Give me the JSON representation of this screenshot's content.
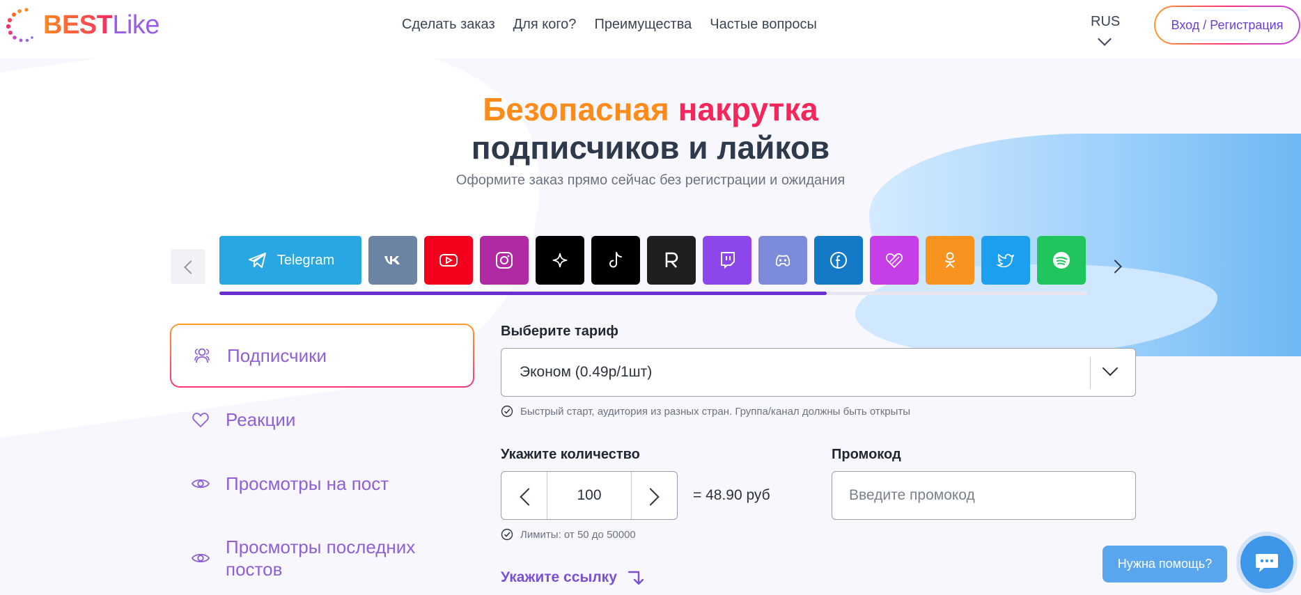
{
  "header": {
    "logo_best": "BEST",
    "logo_like": "Like",
    "nav": [
      "Сделать заказ",
      "Для кого?",
      "Преимущества",
      "Частые вопросы"
    ],
    "language": "RUS",
    "login_label": "Вход / Регистрация"
  },
  "hero": {
    "title_word1": "Безопасная",
    "title_word2": "накрутка",
    "title_line2": "подписчиков и лайков",
    "subtitle": "Оформите заказ прямо сейчас без регистрации и ожидания"
  },
  "platforms": {
    "active_label": "Telegram",
    "items": [
      {
        "name": "telegram",
        "color": "#28a7e3"
      },
      {
        "name": "vk",
        "color": "#6c84a3"
      },
      {
        "name": "youtube",
        "color": "#f2001c"
      },
      {
        "name": "instagram",
        "color": "#b02aa3"
      },
      {
        "name": "threads",
        "color": "#000000"
      },
      {
        "name": "tiktok",
        "color": "#000000"
      },
      {
        "name": "rutube",
        "color": "#1f1f1f"
      },
      {
        "name": "twitch",
        "color": "#8d46ea"
      },
      {
        "name": "discord",
        "color": "#7b8ad9"
      },
      {
        "name": "facebook",
        "color": "#1479c7"
      },
      {
        "name": "likee",
        "color": "#c53ee6"
      },
      {
        "name": "odnoklassniki",
        "color": "#f7931e"
      },
      {
        "name": "twitter",
        "color": "#1d9ff0"
      },
      {
        "name": "spotify",
        "color": "#21c55d"
      }
    ],
    "scroll_progress": 0.7
  },
  "categories": [
    "Подписчики",
    "Реакции",
    "Просмотры на пост",
    "Просмотры последних постов"
  ],
  "form": {
    "tariff_label": "Выберите тариф",
    "tariff_value": "Эконом (0.49р/1шт)",
    "tariff_hint": "Быстрый старт, аудитория из разных стран. Группа/канал должны быть открыты",
    "qty_label": "Укажите количество",
    "qty_value": "100",
    "price": "= 48.90 руб",
    "qty_hint": "Лимиты: от 50 до 50000",
    "promo_label": "Промокод",
    "promo_placeholder": "Введите промокод",
    "link_label": "Укажите ссылку"
  },
  "help": {
    "label": "Нужна помощь?"
  }
}
